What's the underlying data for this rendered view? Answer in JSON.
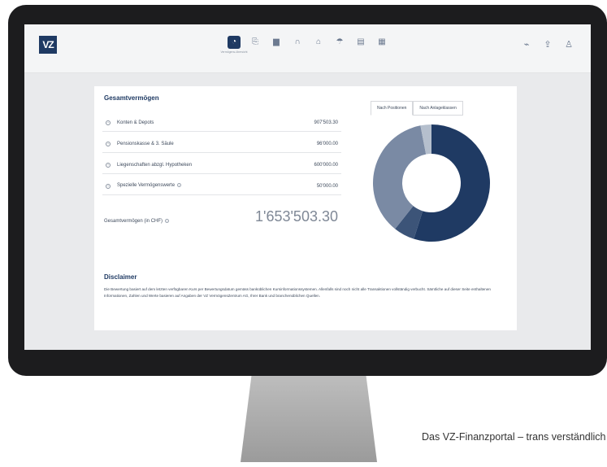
{
  "logo_text": "VZ",
  "nav": {
    "items": [
      {
        "icon": "clock-icon",
        "glyph": "◔",
        "active": true,
        "sub": "Vermögens-übersicht"
      },
      {
        "icon": "document-search-icon",
        "glyph": "⎘",
        "active": false
      },
      {
        "icon": "building-icon",
        "glyph": "▆",
        "active": false
      },
      {
        "icon": "arch-icon",
        "glyph": "∩",
        "active": false
      },
      {
        "icon": "bank-icon",
        "glyph": "⌂",
        "active": false
      },
      {
        "icon": "umbrella-icon",
        "glyph": "☂",
        "active": false
      },
      {
        "icon": "file-icon",
        "glyph": "▤",
        "active": false
      },
      {
        "icon": "calculator-icon",
        "glyph": "▦",
        "active": false
      }
    ]
  },
  "actions": [
    {
      "icon": "chart-icon",
      "glyph": "⌁"
    },
    {
      "icon": "upload-icon",
      "glyph": "⇪"
    },
    {
      "icon": "user-icon",
      "glyph": "♙"
    }
  ],
  "panel": {
    "title": "Gesamtvermögen",
    "tabs": [
      "Nach Positionen",
      "Nach Anlageklassen"
    ],
    "rows": [
      {
        "label": "Konten & Depots",
        "value": "907'503.30"
      },
      {
        "label": "Pensionskasse & 3. Säule",
        "value": "96'000.00"
      },
      {
        "label": "Liegenschaften abzgl. Hypotheken",
        "value": "600'000.00"
      },
      {
        "label": "Spezielle Vermögenswerte",
        "value": "50'000.00",
        "info": "i"
      }
    ],
    "total_label": "Gesamtvermögen (in CHF)",
    "total_info": "i",
    "total_value": "1'653'503.30"
  },
  "chart_data": {
    "type": "pie",
    "categories": [
      "Konten & Depots",
      "Pensionskasse & 3. Säule",
      "Liegenschaften abzgl. Hypotheken",
      "Spezielle Vermögenswerte"
    ],
    "values": [
      907503.3,
      96000.0,
      600000.0,
      50000.0
    ],
    "colors": [
      "#1f3a63",
      "#3c5478",
      "#7a8aa4",
      "#b5bfcd"
    ]
  },
  "disclaimer": {
    "title": "Disclaimer",
    "text": "Die Bewertung basiert auf dem letzten verfügbaren Kurs per Bewertungsdatum gemäss banküblichen Kursinformationssystemen. Allenfalls sind noch nicht alle Transaktionen vollständig verbucht. Sämtliche auf dieser Seite enthaltenen Informationen, Zahlen und Werte basieren auf Angaben der VZ VermögensZentrum AG, Ihrer Bank und branchenüblichen Quellen."
  },
  "caption": "Das VZ-Finanzportal – trans verständlich"
}
